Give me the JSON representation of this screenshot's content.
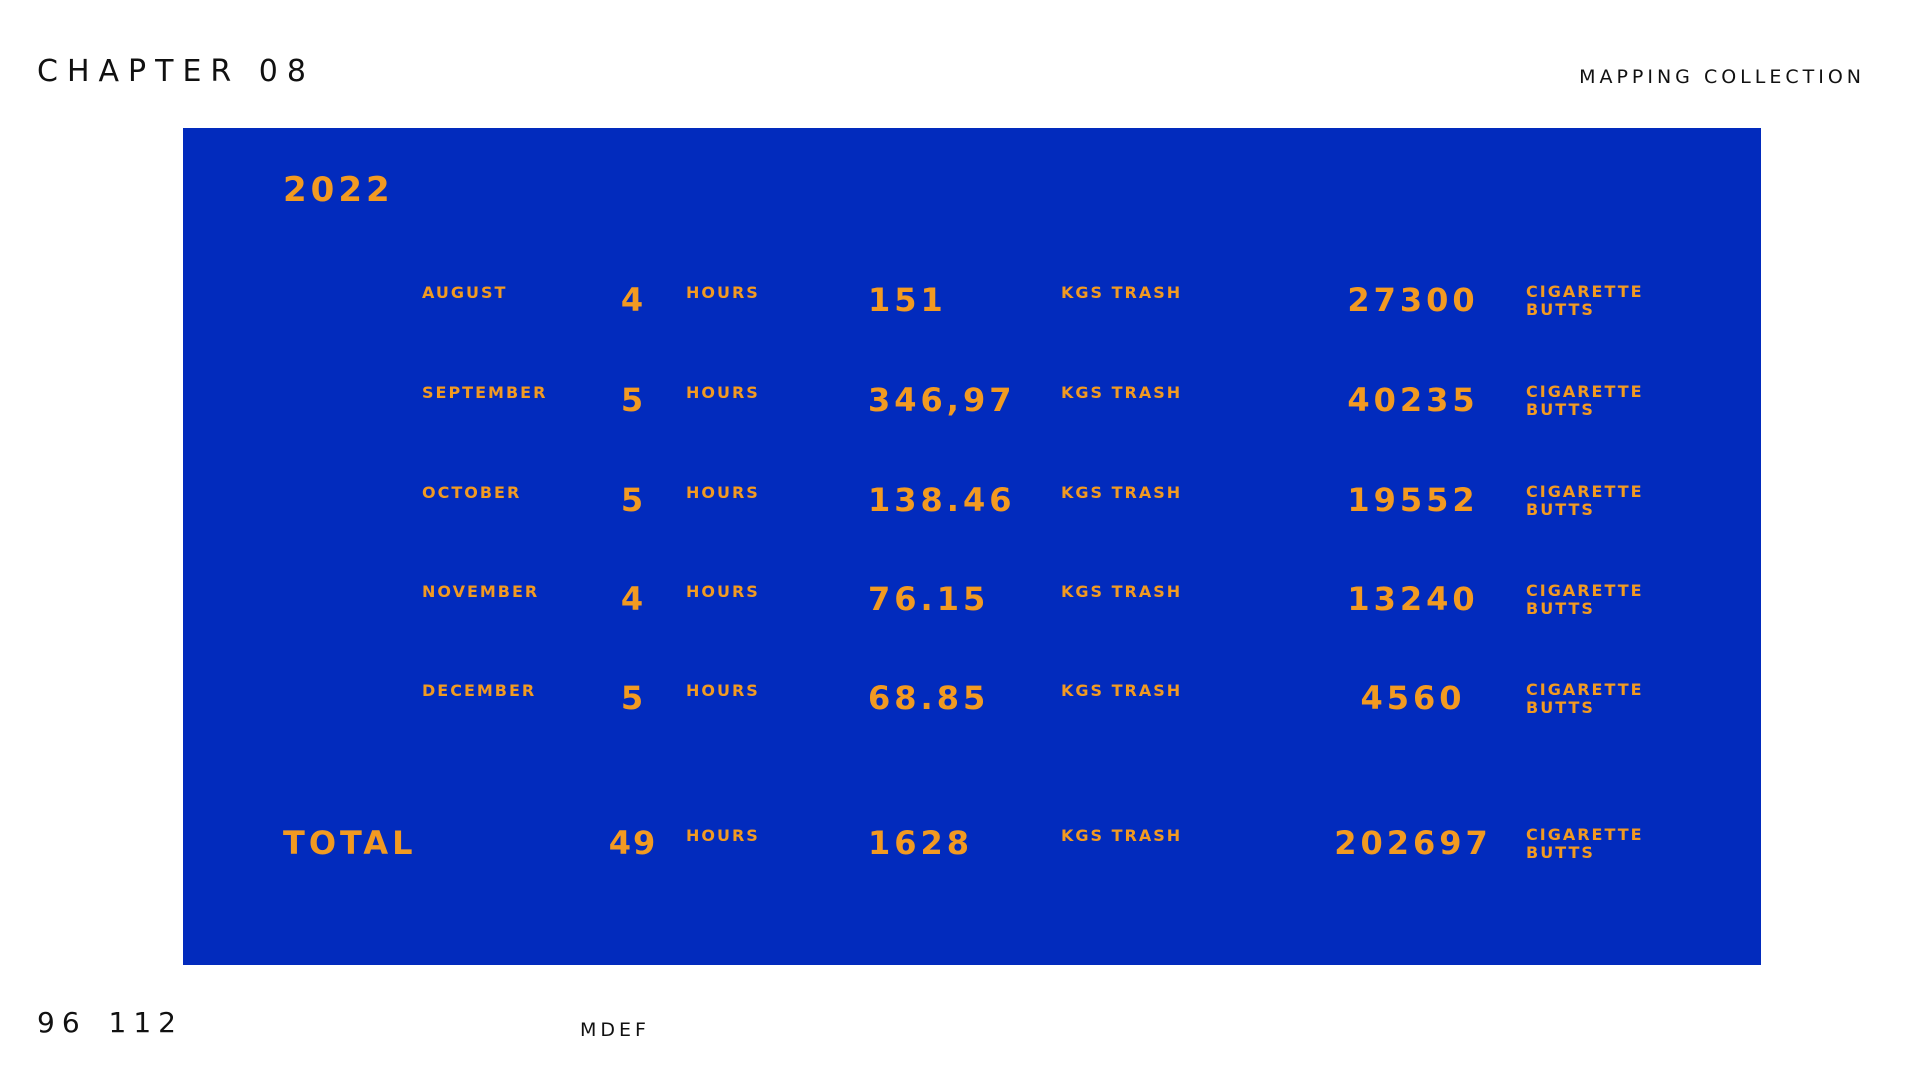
{
  "header": {
    "chapter": "CHAPTER 08",
    "section": "MAPPING COLLECTION"
  },
  "footer": {
    "page_numbers": "96 112",
    "label": "MDEF"
  },
  "panel": {
    "year": "2022",
    "colors": {
      "background": "#022bbd",
      "text": "#f29a21"
    },
    "rows": [
      {
        "month": "AUGUST",
        "hours": "4",
        "hours_unit": "HOURS",
        "trash": "151",
        "trash_unit": "KGS TRASH",
        "butts": "27300",
        "butts_unit": "CIGARETTE BUTTS"
      },
      {
        "month": "SEPTEMBER",
        "hours": "5",
        "hours_unit": "HOURS",
        "trash": "346,97",
        "trash_unit": "KGS TRASH",
        "butts": "40235",
        "butts_unit": "CIGARETTE BUTTS"
      },
      {
        "month": "OCTOBER",
        "hours": "5",
        "hours_unit": "HOURS",
        "trash": "138.46",
        "trash_unit": "KGS TRASH",
        "butts": "19552",
        "butts_unit": "CIGARETTE BUTTS"
      },
      {
        "month": "NOVEMBER",
        "hours": "4",
        "hours_unit": "HOURS",
        "trash": "76.15",
        "trash_unit": "KGS TRASH",
        "butts": "13240",
        "butts_unit": "CIGARETTE BUTTS"
      },
      {
        "month": "DECEMBER",
        "hours": "5",
        "hours_unit": "HOURS",
        "trash": "68.85",
        "trash_unit": "KGS TRASH",
        "butts": "4560",
        "butts_unit": "CIGARETTE BUTTS"
      }
    ],
    "total": {
      "label": "TOTAL",
      "hours": "49",
      "hours_unit": "HOURS",
      "trash": "1628",
      "trash_unit": "KGS TRASH",
      "butts": "202697",
      "butts_unit": "CIGARETTE BUTTS"
    }
  }
}
